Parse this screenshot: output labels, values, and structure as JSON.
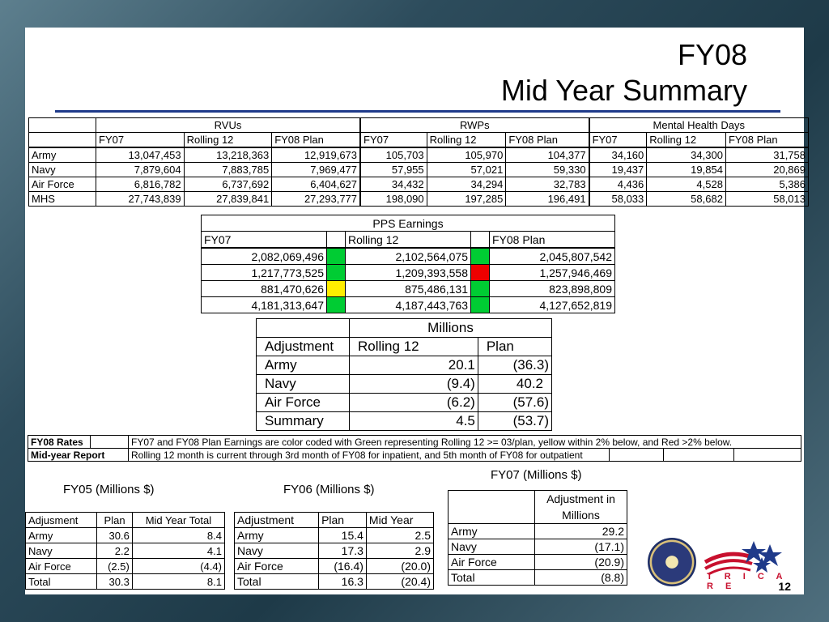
{
  "title_line1": "FY08",
  "title_line2": "Mid Year Summary",
  "main": {
    "groups": [
      "RVUs",
      "RWPs",
      "Mental Health Days"
    ],
    "subheads": [
      "FY07",
      "Rolling 12",
      "FY08 Plan"
    ],
    "rows": [
      {
        "label": "Army",
        "vals": [
          "13,047,453",
          "13,218,363",
          "12,919,673",
          "105,703",
          "105,970",
          "104,377",
          "34,160",
          "34,300",
          "31,758"
        ]
      },
      {
        "label": "Navy",
        "vals": [
          "7,879,604",
          "7,883,785",
          "7,969,477",
          "57,955",
          "57,021",
          "59,330",
          "19,437",
          "19,854",
          "20,869"
        ]
      },
      {
        "label": "Air Force",
        "vals": [
          "6,816,782",
          "6,737,692",
          "6,404,627",
          "34,432",
          "34,294",
          "32,783",
          "4,436",
          "4,528",
          "5,386"
        ]
      },
      {
        "label": "MHS",
        "vals": [
          "27,743,839",
          "27,839,841",
          "27,293,777",
          "198,090",
          "197,285",
          "196,491",
          "58,033",
          "58,682",
          "58,013"
        ]
      }
    ]
  },
  "pps": {
    "title": "PPS Earnings",
    "heads": [
      "FY07",
      "Rolling 12",
      "FY08 Plan"
    ],
    "rows": [
      {
        "fy07": "2,082,069,496",
        "c1": "#00cc33",
        "r12": "2,102,564,075",
        "c2": "#00cc33",
        "plan": "2,045,807,542"
      },
      {
        "fy07": "1,217,773,525",
        "c1": "#00cc33",
        "r12": "1,209,393,558",
        "c2": "#ee0000",
        "plan": "1,257,946,469"
      },
      {
        "fy07": "881,470,626",
        "c1": "#ffee00",
        "r12": "875,486,131",
        "c2": "#00cc33",
        "plan": "823,898,809"
      },
      {
        "fy07": "4,181,313,647",
        "c1": "#00cc33",
        "r12": "4,187,443,763",
        "c2": "#00cc33",
        "plan": "4,127,652,819"
      }
    ]
  },
  "adj": {
    "millions": "Millions",
    "heads": [
      "Adjustment",
      "Rolling 12",
      "Plan"
    ],
    "rows": [
      [
        "Army",
        "20.1",
        "(36.3)"
      ],
      [
        "Navy",
        "(9.4)",
        "40.2"
      ],
      [
        "Air Force",
        "(6.2)",
        "(57.6)"
      ],
      [
        "Summary",
        "4.5",
        "(53.7)"
      ]
    ]
  },
  "notes": [
    {
      "label": "FY08 Rates",
      "text": "FY07 and FY08 Plan Earnings are color coded with Green representing Rolling 12 >= 03/plan, yellow within 2% below, and Red >2% below."
    },
    {
      "label": "Mid-year Report",
      "text": "Rolling 12 month is current through 3rd month of FY08 for inpatient, and 5th month of FY08 for outpatient"
    }
  ],
  "fy05": {
    "caption": "FY05 (Millions $)",
    "heads": [
      "Adjusment",
      "Plan",
      "Mid Year Total"
    ],
    "rows": [
      [
        "Army",
        "30.6",
        "8.4"
      ],
      [
        "Navy",
        "2.2",
        "4.1"
      ],
      [
        "Air Force",
        "(2.5)",
        "(4.4)"
      ],
      [
        "Total",
        "30.3",
        "8.1"
      ]
    ]
  },
  "fy06": {
    "caption": "FY06 (Millions $)",
    "heads": [
      "Adjustment",
      "Plan",
      "Mid Year"
    ],
    "rows": [
      [
        "Army",
        "15.4",
        "2.5"
      ],
      [
        "Navy",
        "17.3",
        "2.9"
      ],
      [
        "Air Force",
        "(16.4)",
        "(20.0)"
      ],
      [
        "Total",
        "16.3",
        "(20.4)"
      ]
    ]
  },
  "fy07": {
    "caption": "FY07 (Millions $)",
    "head": "Adjustment in Millions",
    "rows": [
      [
        "Army",
        "29.2"
      ],
      [
        "Navy",
        "(17.1)"
      ],
      [
        "Air Force",
        "(20.9)"
      ],
      [
        "Total",
        "(8.8)"
      ]
    ]
  },
  "logo_text": "T R I C A R E",
  "page_number": "12"
}
